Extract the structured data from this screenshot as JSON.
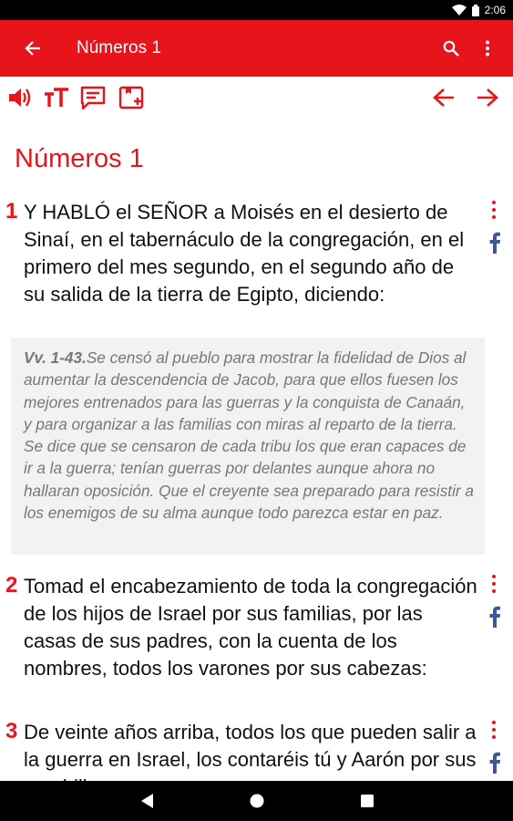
{
  "status_bar": {
    "time": "2:06"
  },
  "app_bar": {
    "title": "Números 1",
    "back_icon": "arrow-back-icon",
    "search_icon": "search-icon",
    "menu_icon": "more-vert-icon"
  },
  "toolbar": {
    "icons": [
      "volume-icon",
      "text-size-icon",
      "comment-icon",
      "add-bookmark-icon"
    ],
    "prev_icon": "arrow-left-icon",
    "next_icon": "arrow-right-icon"
  },
  "chapter": {
    "title": "Números 1"
  },
  "verses": [
    {
      "number": "1",
      "text": "Y HABLÓ el SEÑOR a Moisés en el desierto de Sinaí, en el tabernáculo de la congregación, en el primero del mes segundo, en el segundo año de su salida de la tierra de Egipto, diciendo:"
    },
    {
      "number": "2",
      "text": "Tomad el encabezamiento de toda la congregación de los hijos de Israel por sus familias, por las casas de sus padres, con la cuenta de los nombres, todos los varones por sus cabezas:"
    },
    {
      "number": "3",
      "text": "De veinte años arriba, todos los que pueden salir a la guerra en Israel, los contaréis tú y Aarón por sus cuadrillas."
    }
  ],
  "commentary": {
    "ref": "Vv. 1-43.",
    "text": "Se censó al pueblo para mostrar la fidelidad de Dios al aumentar la descendencia de Jacob, para que ellos fuesen los mejores entrenados para las guerras y la conquista de Canaán, y para organizar a las familias con miras al reparto de la tierra. Se dice que se censaron de cada tribu los que eran capaces de ir a la guerra; tenían guerras por delantes aunque ahora no hallaran oposición. Que el creyente sea preparado para resistir a los enemigos de su alma aunque todo parezca estar en paz."
  },
  "colors": {
    "accent": "#e8141b",
    "commentary_bg": "#f2f2f2",
    "facebook": "#3b5998"
  }
}
